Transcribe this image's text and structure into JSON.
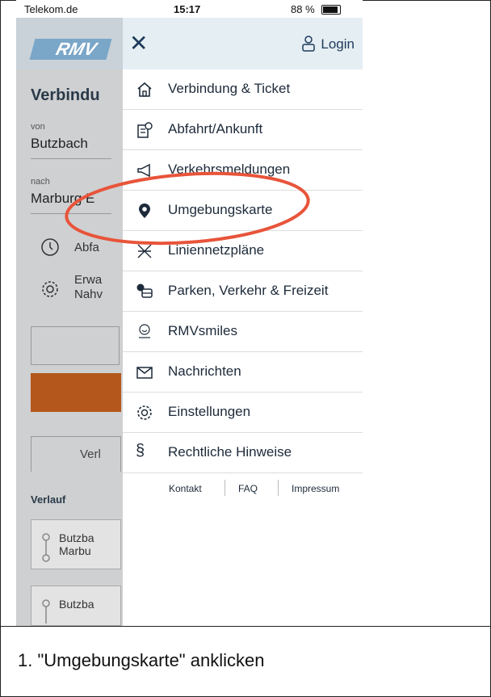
{
  "status_bar": {
    "carrier": "Telekom.de",
    "time": "15:17",
    "battery": "88 %"
  },
  "background_app": {
    "logo": "RMV",
    "title": "Verbindu",
    "from_label": "von",
    "from_value": "Butzbach",
    "to_label": "nach",
    "to_value": "Marburg E",
    "departure": "Abfa",
    "extended_1": "Erwa",
    "extended_2": "Nahv",
    "tab": "Verl",
    "history_heading": "Verlauf",
    "history_1a": "Butzba",
    "history_1b": "Marbu",
    "history_2": "Butzba"
  },
  "drawer": {
    "login": "Login",
    "items": [
      {
        "label": "Verbindung & Ticket",
        "icon": "home-icon"
      },
      {
        "label": "Abfahrt/Ankunft",
        "icon": "departures-icon"
      },
      {
        "label": "Verkehrsmeldungen",
        "icon": "megaphone-icon"
      },
      {
        "label": "Umgebungskarte",
        "icon": "location-pin-icon"
      },
      {
        "label": "Liniennetzpläne",
        "icon": "network-map-icon"
      },
      {
        "label": "Parken, Verkehr & Freizeit",
        "icon": "parking-bus-icon"
      },
      {
        "label": "RMVsmiles",
        "icon": "smiles-icon"
      },
      {
        "label": "Nachrichten",
        "icon": "envelope-icon"
      },
      {
        "label": "Einstellungen",
        "icon": "gear-icon"
      },
      {
        "label": "Rechtliche Hinweise",
        "icon": "paragraph-icon"
      }
    ],
    "footer": {
      "contact": "Kontakt",
      "faq": "FAQ",
      "imprint": "Impressum"
    }
  },
  "highlight_color": "#e8543a",
  "caption": "1. \"Umgebungskarte\"  anklicken"
}
